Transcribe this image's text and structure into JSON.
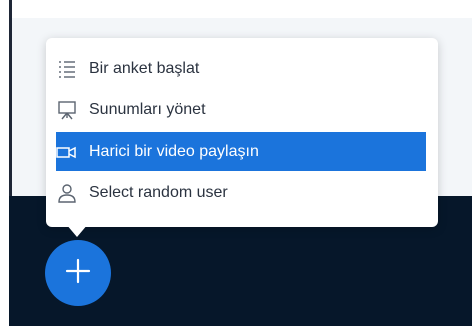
{
  "menu": {
    "items": [
      {
        "label": "Bir anket başlat",
        "icon": "poll-list-icon"
      },
      {
        "label": "Sunumları yönet",
        "icon": "presentation-icon"
      },
      {
        "label": "Harici bir video paylaşın",
        "icon": "video-icon",
        "active": true
      },
      {
        "label": "Select random user",
        "icon": "user-icon"
      }
    ]
  },
  "fab": {
    "icon": "plus-icon"
  },
  "colors": {
    "accent": "#1b74dc",
    "dark_background": "#06172a",
    "text": "#2b3340"
  }
}
